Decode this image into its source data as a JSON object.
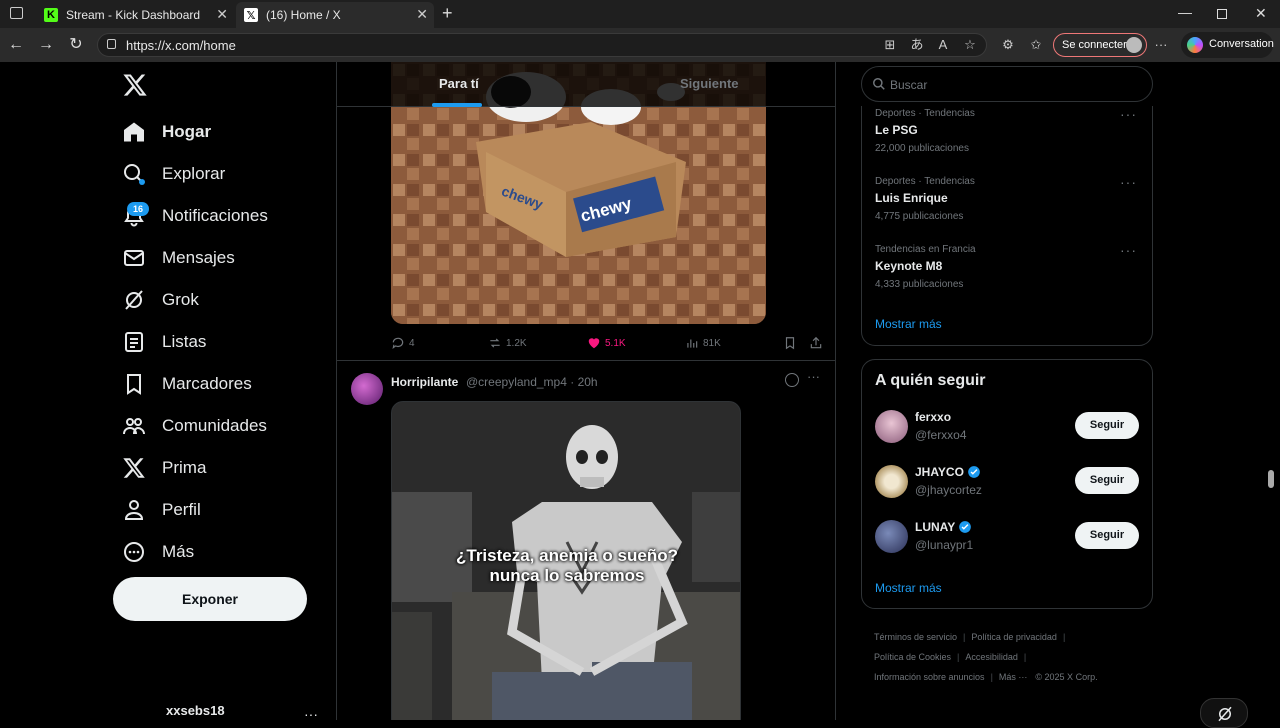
{
  "browser": {
    "tabs": [
      {
        "title": "Stream - Kick Dashboard",
        "favicon": "kick-icon",
        "color": "#53fc18"
      },
      {
        "title": "(16) Home / X",
        "favicon": "x-icon"
      }
    ],
    "url": "https://x.com/home",
    "connect_label": "Se connecter",
    "conversation_label": "Conversation"
  },
  "nav": {
    "items": [
      {
        "label": "Hogar",
        "icon": "home-icon"
      },
      {
        "label": "Explorar",
        "icon": "search-icon"
      },
      {
        "label": "Notificaciones",
        "icon": "bell-icon"
      },
      {
        "label": "Mensajes",
        "icon": "mail-icon"
      },
      {
        "label": "Grok",
        "icon": "grok-icon"
      },
      {
        "label": "Listas",
        "icon": "list-icon"
      },
      {
        "label": "Marcadores",
        "icon": "bookmark-icon"
      },
      {
        "label": "Comunidades",
        "icon": "communities-icon"
      },
      {
        "label": "Prima",
        "icon": "x-icon"
      },
      {
        "label": "Perfil",
        "icon": "person-icon"
      },
      {
        "label": "Más",
        "icon": "more-circle-icon"
      }
    ],
    "notifications_badge": "16",
    "post_button": "Exponer",
    "username": "xxsebs18"
  },
  "feed": {
    "tabs": [
      "Para tí",
      "Siguiente"
    ],
    "tweet1": {
      "replies": "4",
      "retweets": "1.2K",
      "likes": "5.1K",
      "views": "81K"
    },
    "tweet2": {
      "name": "Horripilante",
      "handle": "@creepyland_mp4 · 20h",
      "caption_line1": "¿Tristeza, anemia o sueño?",
      "caption_line2": "nunca lo sabremos"
    }
  },
  "sidebar": {
    "search_placeholder": "Buscar",
    "trends": [
      {
        "context": "Deportes · Tendencias",
        "name": "Le PSG",
        "count": "22,000 publicaciones"
      },
      {
        "context": "Deportes · Tendencias",
        "name": "Luis Enrique",
        "count": "4,775 publicaciones"
      },
      {
        "context": "Tendencias en Francia",
        "name": "Keynote M8",
        "count": "4,333 publicaciones"
      }
    ],
    "trends_show_more": "Mostrar más",
    "who_to_follow_title": "A quién seguir",
    "who_to_follow": [
      {
        "name": "ferxxo",
        "handle": "@ferxxo4",
        "verified": false,
        "button": "Seguir"
      },
      {
        "name": "JHAYCO",
        "handle": "@jhaycortez",
        "verified": true,
        "button": "Seguir"
      },
      {
        "name": "LUNAY",
        "handle": "@lunaypr1",
        "verified": true,
        "button": "Seguir"
      }
    ],
    "follow_show_more": "Mostrar más",
    "footer": {
      "terms": "Términos de servicio",
      "privacy": "Política de privacidad",
      "cookies": "Política de Cookies",
      "accessibility": "Accesibilidad",
      "ads": "Información sobre anuncios",
      "more": "Más ···",
      "copyright": "© 2025 X Corp."
    }
  },
  "colors": {
    "accent": "#1d9bf0",
    "like": "#f91880",
    "background": "#000000",
    "border": "#2f3336"
  }
}
